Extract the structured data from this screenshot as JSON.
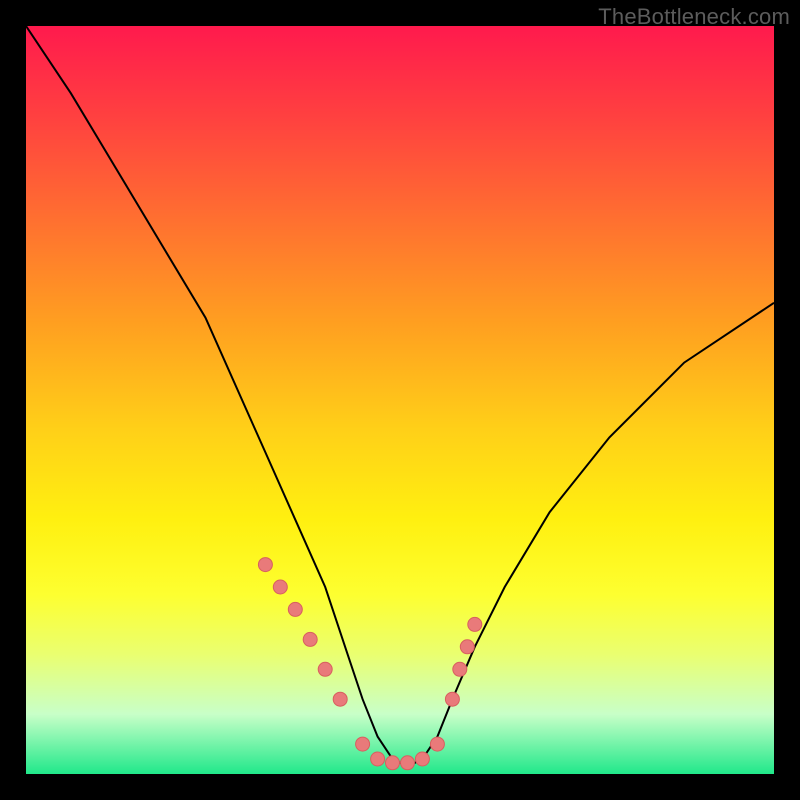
{
  "watermark": "TheBottleneck.com",
  "chart_data": {
    "type": "line",
    "title": "",
    "xlabel": "",
    "ylabel": "",
    "xlim": [
      0,
      100
    ],
    "ylim": [
      0,
      100
    ],
    "series": [
      {
        "name": "curve",
        "x": [
          0,
          6,
          12,
          18,
          24,
          28,
          32,
          36,
          40,
          43,
          45,
          47,
          49,
          51,
          53,
          55,
          57,
          60,
          64,
          70,
          78,
          88,
          100
        ],
        "values": [
          100,
          91,
          81,
          71,
          61,
          52,
          43,
          34,
          25,
          16,
          10,
          5,
          2,
          1,
          2,
          5,
          10,
          17,
          25,
          35,
          45,
          55,
          63
        ]
      }
    ],
    "markers": {
      "name": "dots",
      "x": [
        32,
        34,
        36,
        38,
        40,
        42,
        45,
        47,
        49,
        51,
        53,
        55,
        57,
        58,
        59,
        60
      ],
      "values": [
        28,
        25,
        22,
        18,
        14,
        10,
        4,
        2,
        1.5,
        1.5,
        2,
        4,
        10,
        14,
        17,
        20
      ]
    }
  },
  "colors": {
    "curve": "#000000",
    "markers": "#e97a7a",
    "marker_stroke": "#d85f5f"
  }
}
